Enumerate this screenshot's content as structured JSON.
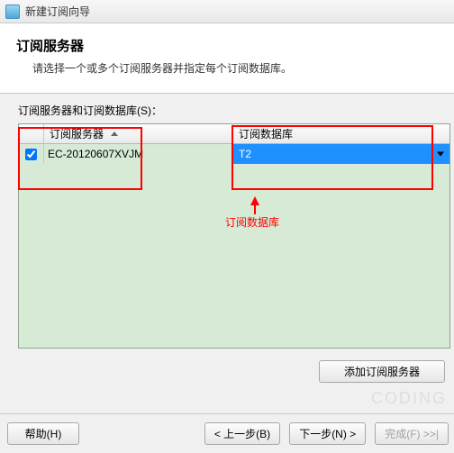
{
  "window": {
    "title": "新建订阅向导"
  },
  "header": {
    "title": "订阅服务器",
    "subtitle": "请选择一个或多个订阅服务器并指定每个订阅数据库。"
  },
  "grid": {
    "label": "订阅服务器和订阅数据库(S)：",
    "columns": {
      "server": "订阅服务器",
      "database": "订阅数据库"
    },
    "rows": [
      {
        "checked": true,
        "server": "EC-20120607XVJM",
        "database": "T2"
      }
    ]
  },
  "annotation": {
    "label": "订阅数据库"
  },
  "buttons": {
    "add_server": "添加订阅服务器",
    "help": "帮助(H)",
    "back": "< 上一步(B)",
    "next": "下一步(N) >",
    "finish": "完成(F) >>|"
  },
  "watermark": "CODING"
}
